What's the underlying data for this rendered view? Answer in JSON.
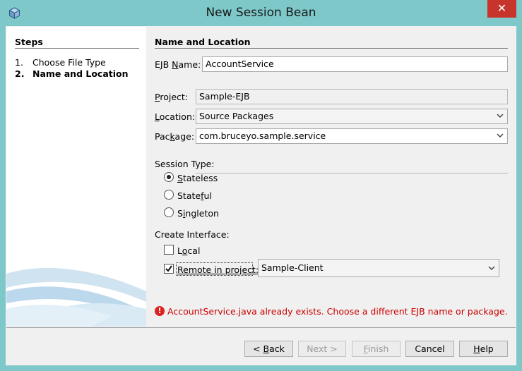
{
  "window": {
    "title": "New Session Bean",
    "close_glyph": "✕",
    "app_icon": "cube-icon"
  },
  "steps": {
    "title": "Steps",
    "items": [
      {
        "num": "1.",
        "label": "Choose File Type"
      },
      {
        "num": "2.",
        "label": "Name and Location"
      }
    ]
  },
  "form": {
    "section_title": "Name and Location",
    "ejb_name": {
      "label_pre": "EJB ",
      "label_mn": "N",
      "label_post": "ame:",
      "value": "AccountService"
    },
    "project": {
      "label_pre": "",
      "label_mn": "P",
      "label_post": "roject:",
      "value": "Sample-EJB"
    },
    "location": {
      "label_pre": "",
      "label_mn": "L",
      "label_post": "ocation:",
      "value": "Source Packages"
    },
    "package": {
      "label_pre": "Pac",
      "label_mn": "k",
      "label_post": "age:",
      "value": "com.bruceyo.sample.service"
    },
    "session_type": {
      "label": "Session Type:",
      "selected": "Stateless",
      "options": [
        {
          "pre": "",
          "mn": "S",
          "post": "tateless"
        },
        {
          "pre": "State",
          "mn": "f",
          "post": "ul"
        },
        {
          "pre": "S",
          "mn": "i",
          "post": "ngleton"
        }
      ]
    },
    "create_interface": {
      "label": "Create Interface:",
      "local": {
        "pre": "L",
        "mn": "o",
        "post": "cal",
        "checked": false
      },
      "remote": {
        "pre": "",
        "mn": "R",
        "post": "emote in project:",
        "checked": true,
        "project": "Sample-Client"
      }
    },
    "error": {
      "icon": "error-icon",
      "glyph": "!",
      "text": "AccountService.java already exists. Choose a different EJB name or package."
    }
  },
  "buttons": {
    "back": {
      "pre": "< ",
      "mn": "B",
      "post": "ack"
    },
    "next": {
      "label": "Next >"
    },
    "finish": {
      "pre": "",
      "mn": "F",
      "post": "inish"
    },
    "cancel": {
      "label": "Cancel"
    },
    "help": {
      "pre": "",
      "mn": "H",
      "post": "elp"
    }
  },
  "colors": {
    "frame": "#7ec8c9",
    "close": "#c7342b",
    "error": "#cc0000"
  }
}
